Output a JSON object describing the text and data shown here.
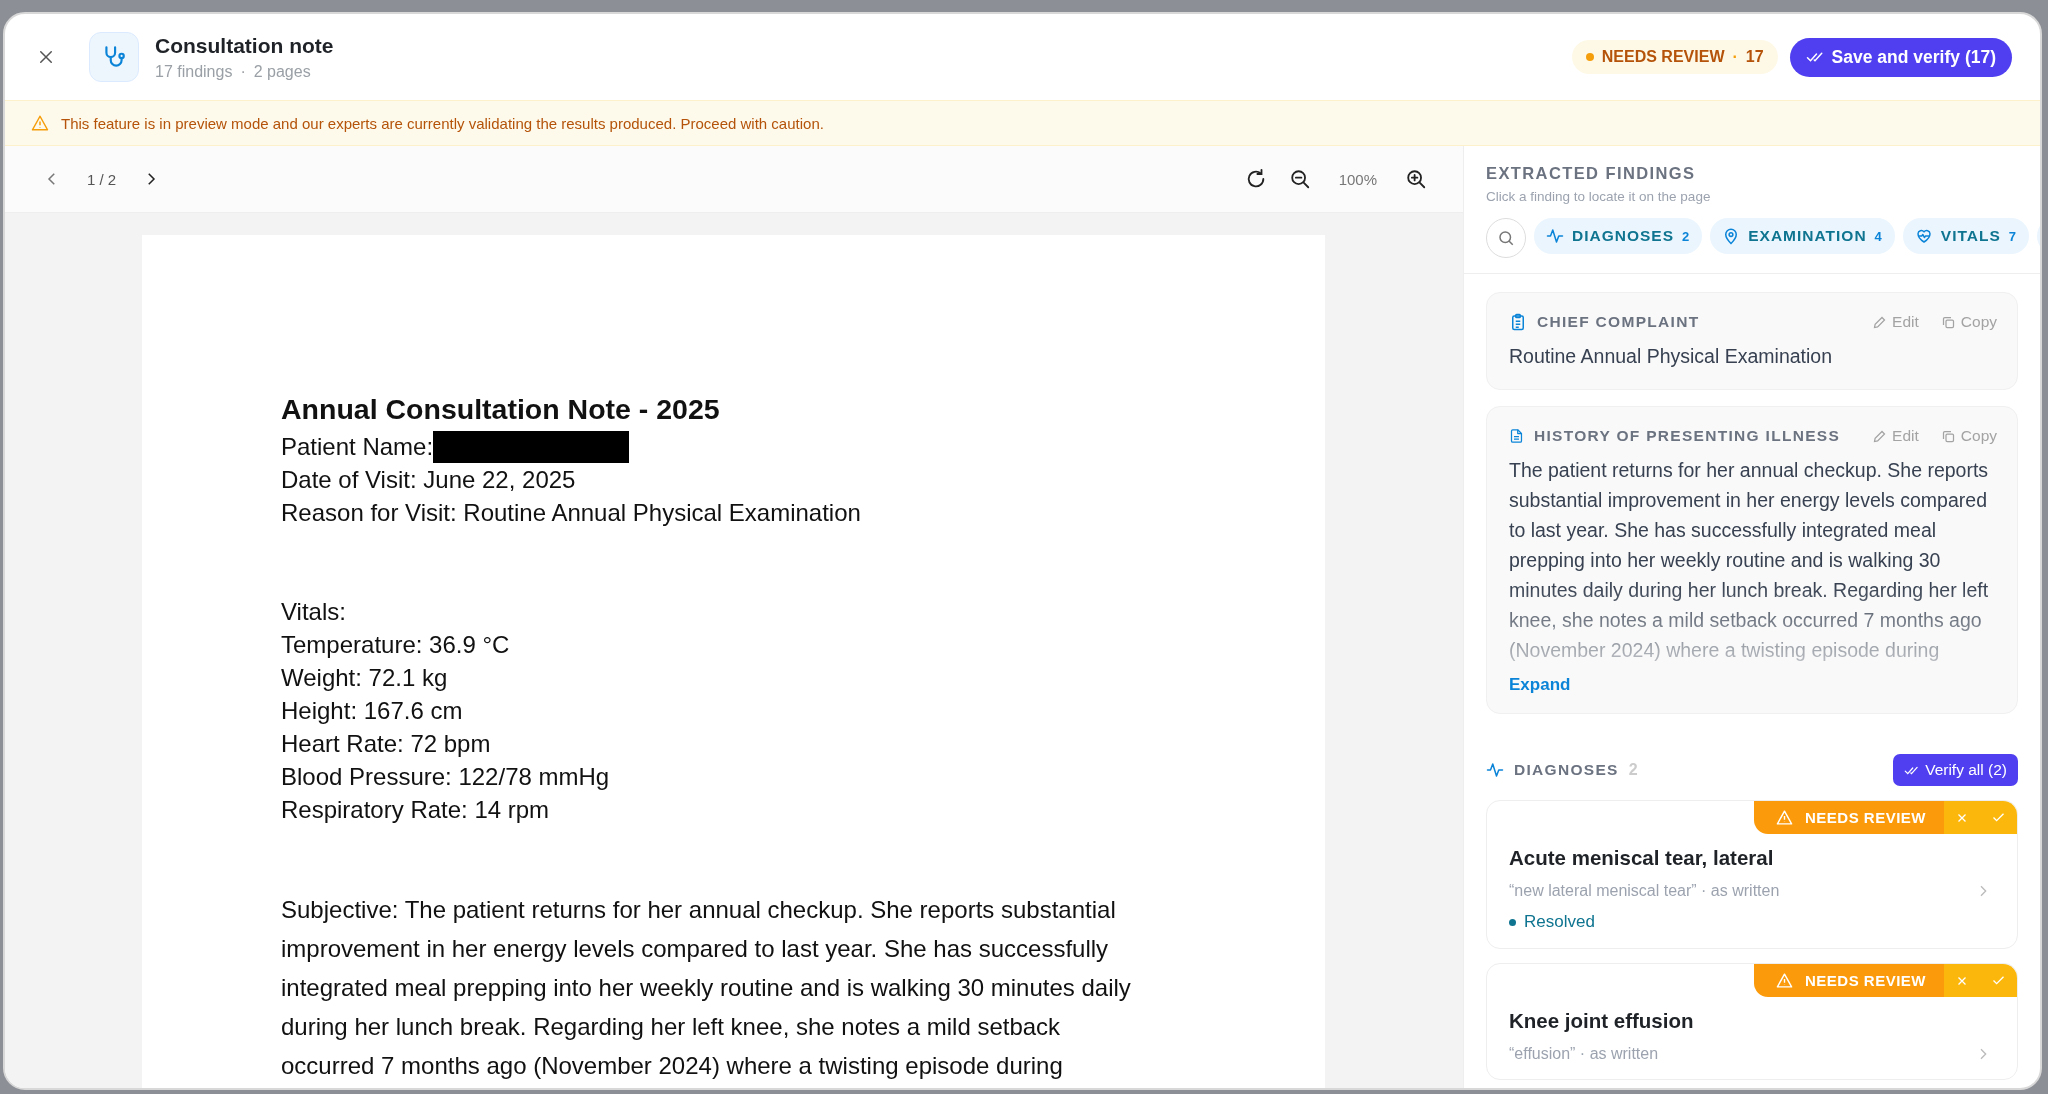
{
  "header": {
    "title": "Consultation note",
    "findings": "17 findings",
    "separator": "·",
    "pages": "2 pages",
    "status": {
      "label": "NEEDS REVIEW",
      "separator": "·",
      "count": "17"
    },
    "save_button": "Save and verify (17)"
  },
  "banner": "This feature is in preview mode and our experts are currently validating the results produced. Proceed with caution.",
  "viewer": {
    "page_indicator": "1 / 2",
    "zoom": "100%",
    "document": {
      "heading": "Annual Consultation Note - 2025",
      "header_lines": [
        {
          "text": "Patient Name:",
          "redacted": true
        },
        {
          "text": "Date of Visit: June 22, 2025",
          "redacted": false
        },
        {
          "text": "Reason for Visit: Routine Annual Physical Examination",
          "redacted": false
        }
      ],
      "vitals_label": "Vitals:",
      "vitals": [
        "Temperature: 36.9 °C",
        "Weight: 72.1 kg",
        "Height: 167.6 cm",
        "Heart Rate: 72 bpm",
        "Blood Pressure: 122/78 mmHg",
        "Respiratory Rate: 14 rpm"
      ],
      "subjective": "Subjective: The patient returns for her annual checkup. She reports substantial improvement in her energy levels compared to last year. She has successfully integrated meal prepping into her weekly routine and is walking 30 minutes daily during her lunch break. Regarding her left knee, she notes a mild setback occurred 7 months ago (November 2024) where a twisting episode during"
    }
  },
  "findings": {
    "title": "EXTRACTED FINDINGS",
    "hint": "Click a finding to locate it on the page",
    "chips": [
      {
        "kind": "pulse",
        "label": "DIAGNOSES",
        "count": "2"
      },
      {
        "kind": "pin",
        "label": "EXAMINATION",
        "count": "4"
      },
      {
        "kind": "heart",
        "label": "VITALS",
        "count": "7"
      }
    ],
    "cards": [
      {
        "kind": "clipboard",
        "title": "CHIEF COMPLAINT",
        "edit": "Edit",
        "copy": "Copy",
        "text": "Routine Annual Physical Examination",
        "faded": false
      },
      {
        "kind": "document",
        "title": "HISTORY OF PRESENTING ILLNESS",
        "edit": "Edit",
        "copy": "Copy",
        "text": "The patient returns for her annual checkup. She reports substantial improvement in her energy levels compared to last year. She has successfully integrated meal prepping into her weekly routine and is walking 30 minutes daily during her lunch break. Regarding her left knee, she notes a mild setback occurred 7 months ago (November 2024) where a twisting episode during",
        "faded": true,
        "expand": "Expand"
      }
    ],
    "diagnoses": {
      "title": "DIAGNOSES",
      "count": "2",
      "verify_button": "Verify all (2)",
      "items": [
        {
          "badge": "NEEDS REVIEW",
          "title": "Acute meniscal tear, lateral",
          "quote": "“new lateral meniscal tear” · as written",
          "status": "Resolved",
          "color": "#0e7490"
        },
        {
          "badge": "NEEDS REVIEW",
          "title": "Knee joint effusion",
          "quote": "“effusion” · as written"
        }
      ]
    }
  }
}
